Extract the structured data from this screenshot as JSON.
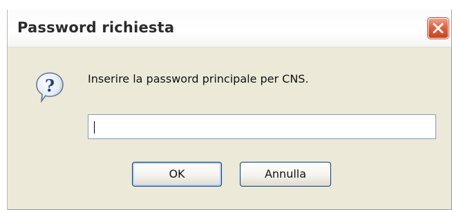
{
  "dialog": {
    "title": "Password richiesta",
    "close_icon": "close-icon",
    "icon": "help-question-icon",
    "message": "Inserire la password principale per CNS.",
    "password_value": "",
    "buttons": {
      "ok_label": "OK",
      "cancel_label": "Annulla"
    }
  },
  "colors": {
    "dialog_bg": "#ece9d8",
    "close_button": "#e0623f",
    "field_border": "#7f9db9",
    "button_border": "#003c74"
  }
}
